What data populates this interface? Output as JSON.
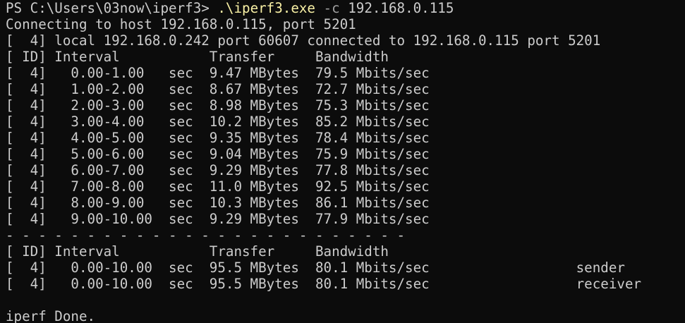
{
  "window": {
    "prompt": "PS C:\\Users\\03now\\iperf3> ",
    "command_exe": ".\\iperf3.exe",
    "command_flag": "-c",
    "command_arg": "192.168.0.115"
  },
  "output": {
    "connecting": "Connecting to host 192.168.0.115, port 5201",
    "local": "[  4] local 192.168.0.242 port 60607 connected to 192.168.0.115 port 5201",
    "header": "[ ID] Interval           Transfer     Bandwidth",
    "rows": [
      "[  4]   0.00-1.00   sec  9.47 MBytes  79.5 Mbits/sec",
      "[  4]   1.00-2.00   sec  8.67 MBytes  72.7 Mbits/sec",
      "[  4]   2.00-3.00   sec  8.98 MBytes  75.3 Mbits/sec",
      "[  4]   3.00-4.00   sec  10.2 MBytes  85.2 Mbits/sec",
      "[  4]   4.00-5.00   sec  9.35 MBytes  78.4 Mbits/sec",
      "[  4]   5.00-6.00   sec  9.04 MBytes  75.9 Mbits/sec",
      "[  4]   6.00-7.00   sec  9.29 MBytes  77.8 Mbits/sec",
      "[  4]   7.00-8.00   sec  11.0 MBytes  92.5 Mbits/sec",
      "[  4]   8.00-9.00   sec  10.3 MBytes  86.1 Mbits/sec",
      "[  4]   9.00-10.00  sec  9.29 MBytes  77.9 Mbits/sec"
    ],
    "separator": "- - - - - - - - - - - - - - - - - - - - - - - - -",
    "summary_header": "[ ID] Interval           Transfer     Bandwidth",
    "summary_rows": [
      "[  4]   0.00-10.00  sec  95.5 MBytes  80.1 Mbits/sec                  sender",
      "[  4]   0.00-10.00  sec  95.5 MBytes  80.1 Mbits/sec                  receiver"
    ],
    "blank": "",
    "done": "iperf Done."
  },
  "colors": {
    "background": "#0c0c0c",
    "text": "#cccccc",
    "command": "#f9f1a5",
    "flag": "#a0a0a0"
  }
}
